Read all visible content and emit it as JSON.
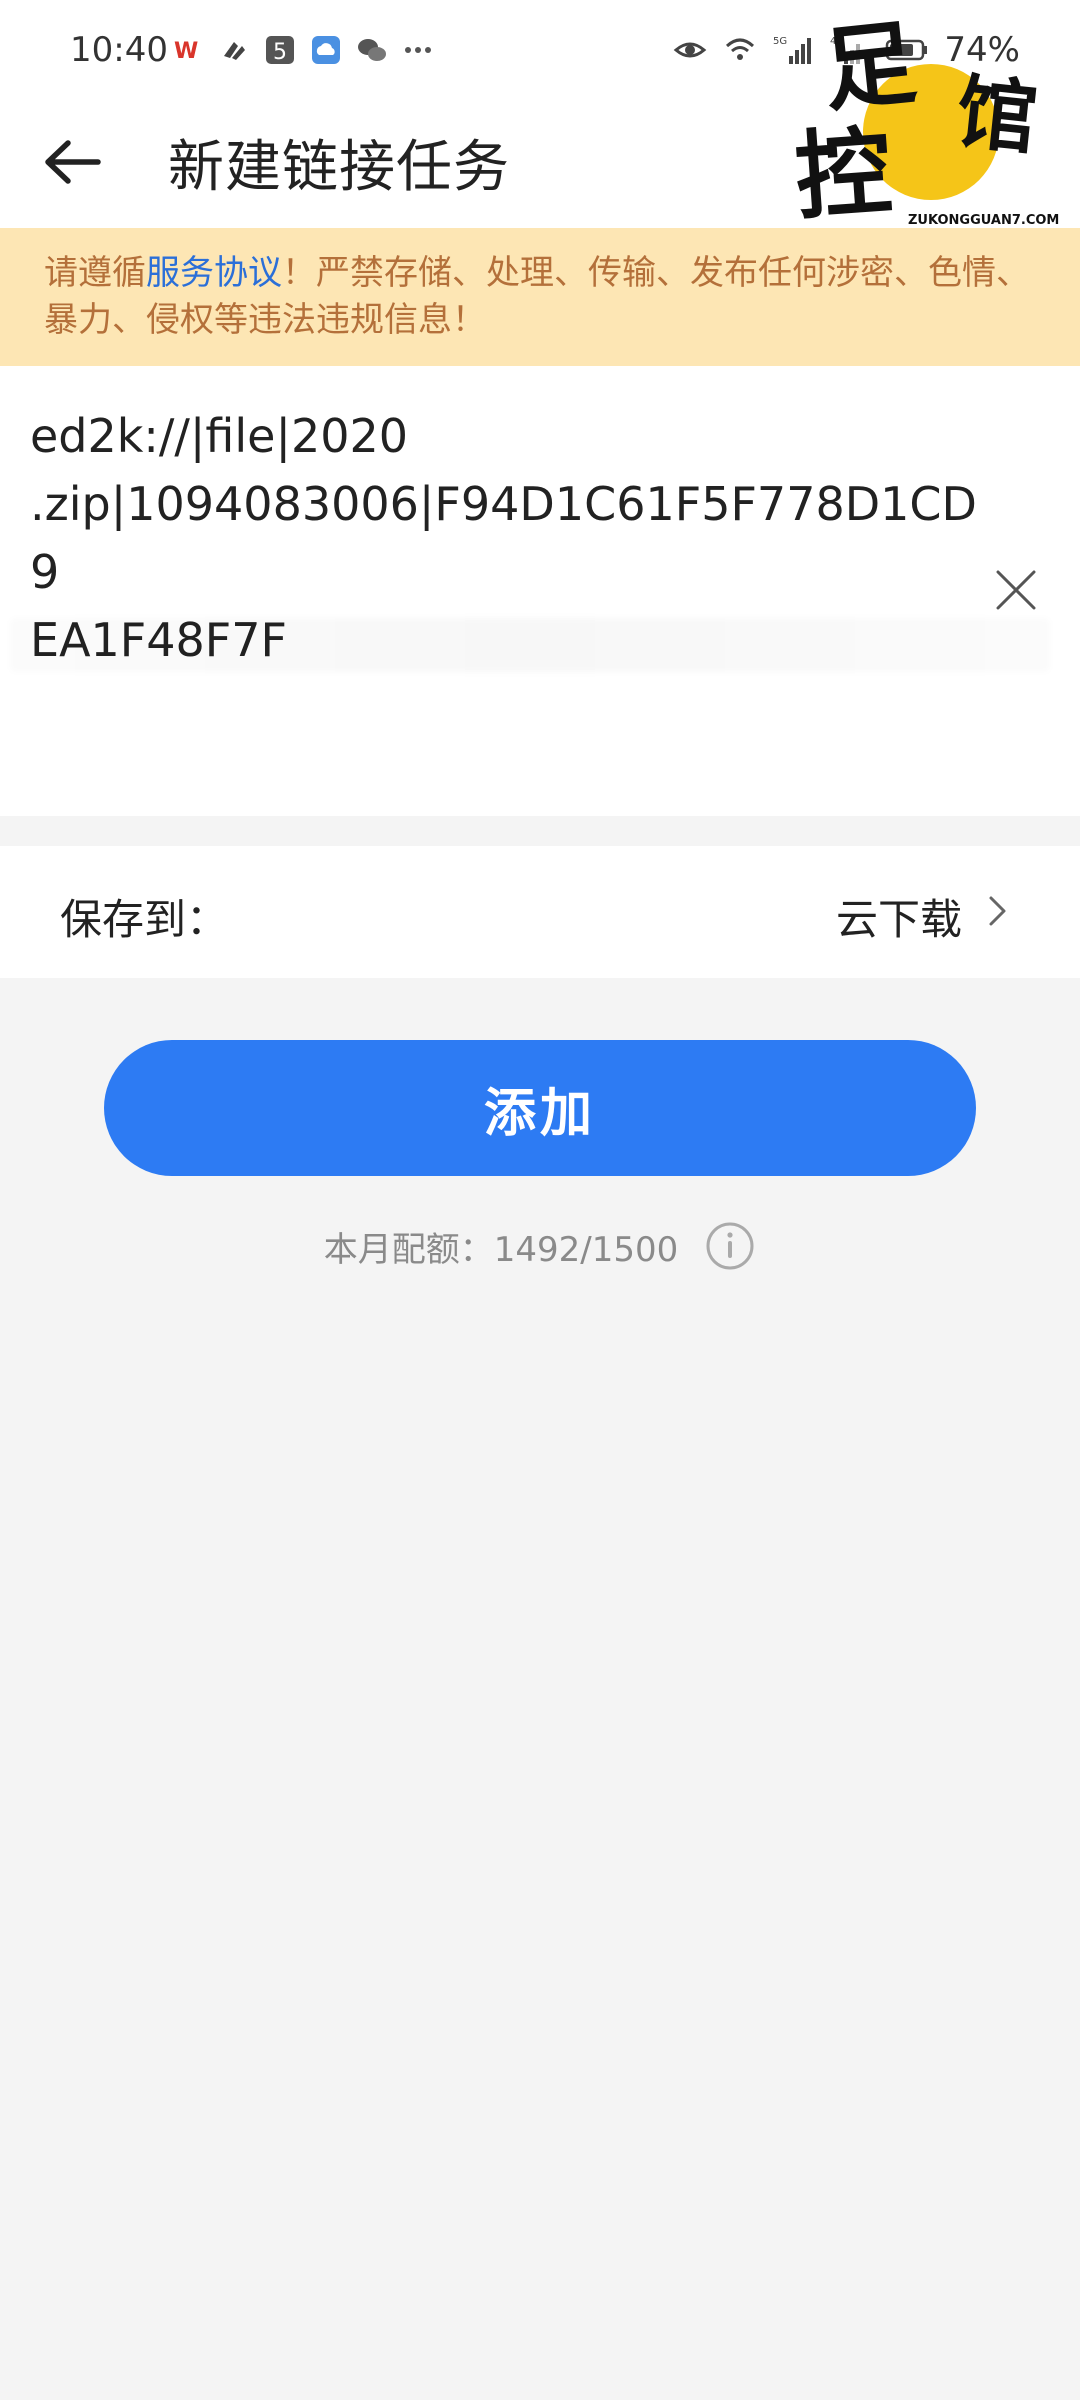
{
  "status_bar": {
    "time": "10:40",
    "battery": "74%",
    "icons_left": [
      "wps-icon",
      "app-icon",
      "five-icon",
      "cloud-icon",
      "wechat-icon",
      "more-dots-icon"
    ],
    "icons_right": [
      "eye-icon",
      "wifi-icon",
      "signal-5g-icon",
      "signal-4g-icon",
      "battery-icon"
    ]
  },
  "header": {
    "title": "新建链接任务",
    "logo_text": "足馆控",
    "logo_sub": "ZUKONGGUAN7.COM"
  },
  "notice": {
    "prefix": "请遵循",
    "link": "服务协议",
    "suffix": "！严禁存储、处理、传输、发布任何涉密、色情、暴力、侵权等违法违规信息！"
  },
  "link_input": {
    "value": "ed2k://|file|2020\n.zip|1094083006|F94D1C61F5F778D1CD9\nEA1F48F7F"
  },
  "save_row": {
    "label": "保存到：",
    "value": "云下载"
  },
  "add_button": {
    "label": "添加"
  },
  "quota": {
    "text": "本月配额：1492/1500"
  },
  "colors": {
    "accent": "#2d7bf3",
    "notice_bg": "#fde6b4",
    "notice_text": "#b4703a",
    "link": "#2b6fd8",
    "logo_circle": "#f5c518"
  }
}
